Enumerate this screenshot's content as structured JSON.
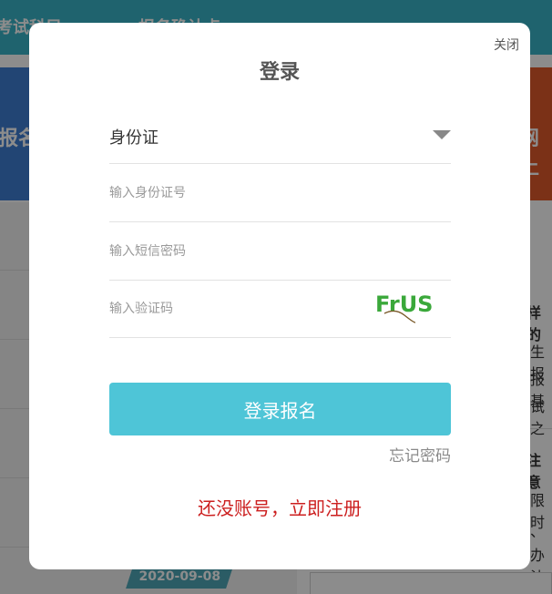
{
  "background": {
    "nav_items": [
      "考试科目",
      "报名确认点"
    ],
    "banner_left": "报名",
    "banner_right": "网上",
    "side_texts": [
      "样的",
      "生报",
      "报基",
      "试之",
      "注意",
      "限时",
      "、",
      "办法"
    ],
    "list_date": "2020-09-08"
  },
  "modal": {
    "close_label": "关闭",
    "title": "登录",
    "id_type_selected": "身份证",
    "id_number_placeholder": "输入身份证号",
    "sms_code_placeholder": "输入短信密码",
    "captcha_placeholder": "输入验证码",
    "captcha_text": "FrUS",
    "login_button": "登录报名",
    "forgot_password": "忘记密码",
    "register_link": "还没账号，立即注册"
  },
  "colors": {
    "accent": "#4ec5d7",
    "register_red": "#cc1f1f",
    "captcha_green": "#3aa83a"
  }
}
